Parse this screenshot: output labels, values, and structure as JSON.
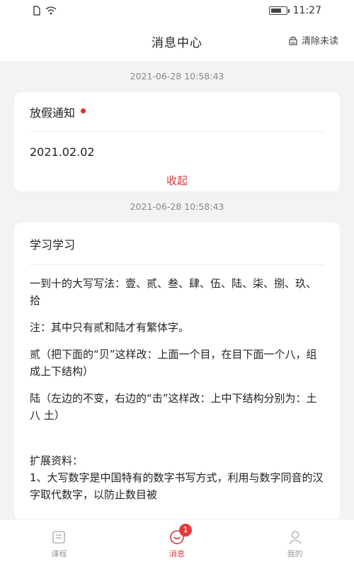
{
  "status_bar": {
    "time": "11:27"
  },
  "header": {
    "title": "消息中心",
    "clear_label": "清除未读"
  },
  "messages": [
    {
      "timestamp": "2021-06-28 10:58:43",
      "title": "放假通知",
      "unread": true,
      "date": "2021.02.02",
      "collapse_label": "收起"
    },
    {
      "timestamp": "2021-06-28 10:58:43",
      "title": "学习学习",
      "paragraphs": [
        "一到十的大写写法：壹、贰、叁、肆、伍、陆、柒、捌、玖、拾",
        "注：其中只有贰和陆才有繁体字。",
        "贰（把下面的“贝”这样改：上面一个目，在目下面一个八，组成上下结构）",
        "陆（左边的不变，右边的“击”这样改：上中下结构分别为：土 八 土）",
        "扩展资料：",
        "1、大写数字是中国特有的数字书写方式，利用与数字同音的汉字取代数字，以防止数目被"
      ]
    }
  ],
  "tabbar": {
    "tabs": [
      {
        "label": "课程"
      },
      {
        "label": "消息",
        "badge": "1"
      },
      {
        "label": "我的"
      }
    ]
  },
  "colors": {
    "accent": "#d8393a",
    "badge": "#e33b3b",
    "background": "#f3f3f3"
  }
}
